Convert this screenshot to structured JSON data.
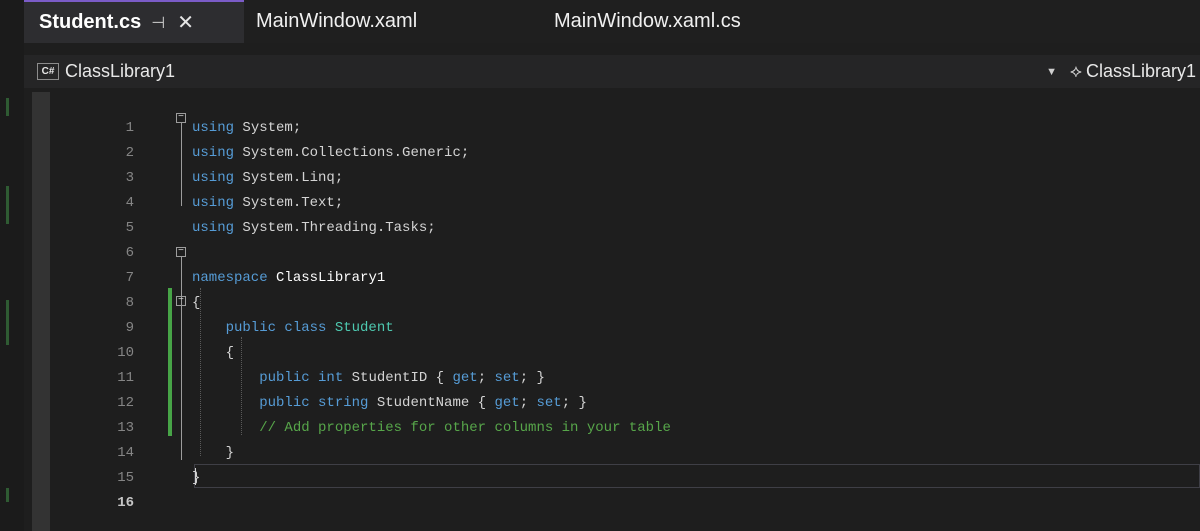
{
  "tabs": [
    {
      "label": "Student.cs",
      "active": true,
      "pin_icon": "pin-icon",
      "close_icon": "close-icon"
    },
    {
      "label": "MainWindow.xaml",
      "active": false
    },
    {
      "label": "MainWindow.xaml.cs",
      "active": false
    }
  ],
  "navbar": {
    "language_badge": "C#",
    "project": "ClassLibrary1",
    "dropdown_icon": "chevron-down-icon",
    "class_icon": "class-icon",
    "class_scope": "ClassLibrary1"
  },
  "editor": {
    "current_line": 16,
    "line_numbers": [
      "1",
      "2",
      "3",
      "4",
      "5",
      "6",
      "7",
      "8",
      "9",
      "10",
      "11",
      "12",
      "13",
      "14",
      "15",
      "16"
    ],
    "lines": [
      [
        {
          "t": "using",
          "c": "kw"
        },
        {
          "t": " System;",
          "c": "tx"
        }
      ],
      [
        {
          "t": "using",
          "c": "kw"
        },
        {
          "t": " System.Collections.Generic;",
          "c": "tx"
        }
      ],
      [
        {
          "t": "using",
          "c": "kw"
        },
        {
          "t": " System.Linq;",
          "c": "tx"
        }
      ],
      [
        {
          "t": "using",
          "c": "kw"
        },
        {
          "t": " System.Text;",
          "c": "tx"
        }
      ],
      [
        {
          "t": "using",
          "c": "kw"
        },
        {
          "t": " System.Threading.Tasks;",
          "c": "tx"
        }
      ],
      [],
      [
        {
          "t": "namespace",
          "c": "kw"
        },
        {
          "t": " ClassLibrary1",
          "c": "ns"
        }
      ],
      [
        {
          "t": "{",
          "c": "tx"
        }
      ],
      [
        {
          "t": "    public class ",
          "c": "kw"
        },
        {
          "t": "Student",
          "c": "ty"
        }
      ],
      [
        {
          "t": "    {",
          "c": "tx"
        }
      ],
      [
        {
          "t": "        public int ",
          "c": "kw"
        },
        {
          "t": "StudentID { ",
          "c": "tx"
        },
        {
          "t": "get",
          "c": "kw"
        },
        {
          "t": "; ",
          "c": "tx"
        },
        {
          "t": "set",
          "c": "kw"
        },
        {
          "t": "; }",
          "c": "tx"
        }
      ],
      [
        {
          "t": "        public string ",
          "c": "kw"
        },
        {
          "t": "StudentName { ",
          "c": "tx"
        },
        {
          "t": "get",
          "c": "kw"
        },
        {
          "t": "; ",
          "c": "tx"
        },
        {
          "t": "set",
          "c": "kw"
        },
        {
          "t": "; }",
          "c": "tx"
        }
      ],
      [
        {
          "t": "        // Add properties for other columns in your table",
          "c": "cm"
        }
      ],
      [
        {
          "t": "    }",
          "c": "tx"
        }
      ],
      [
        {
          "t": "}",
          "c": "tx"
        }
      ],
      []
    ]
  },
  "colors": {
    "keyword": "#569cd6",
    "type": "#4ec9b0",
    "comment": "#57a64a",
    "text": "#d4d4d4",
    "change_bar": "#47a447",
    "active_tab_accent": "#7b5cc8"
  }
}
